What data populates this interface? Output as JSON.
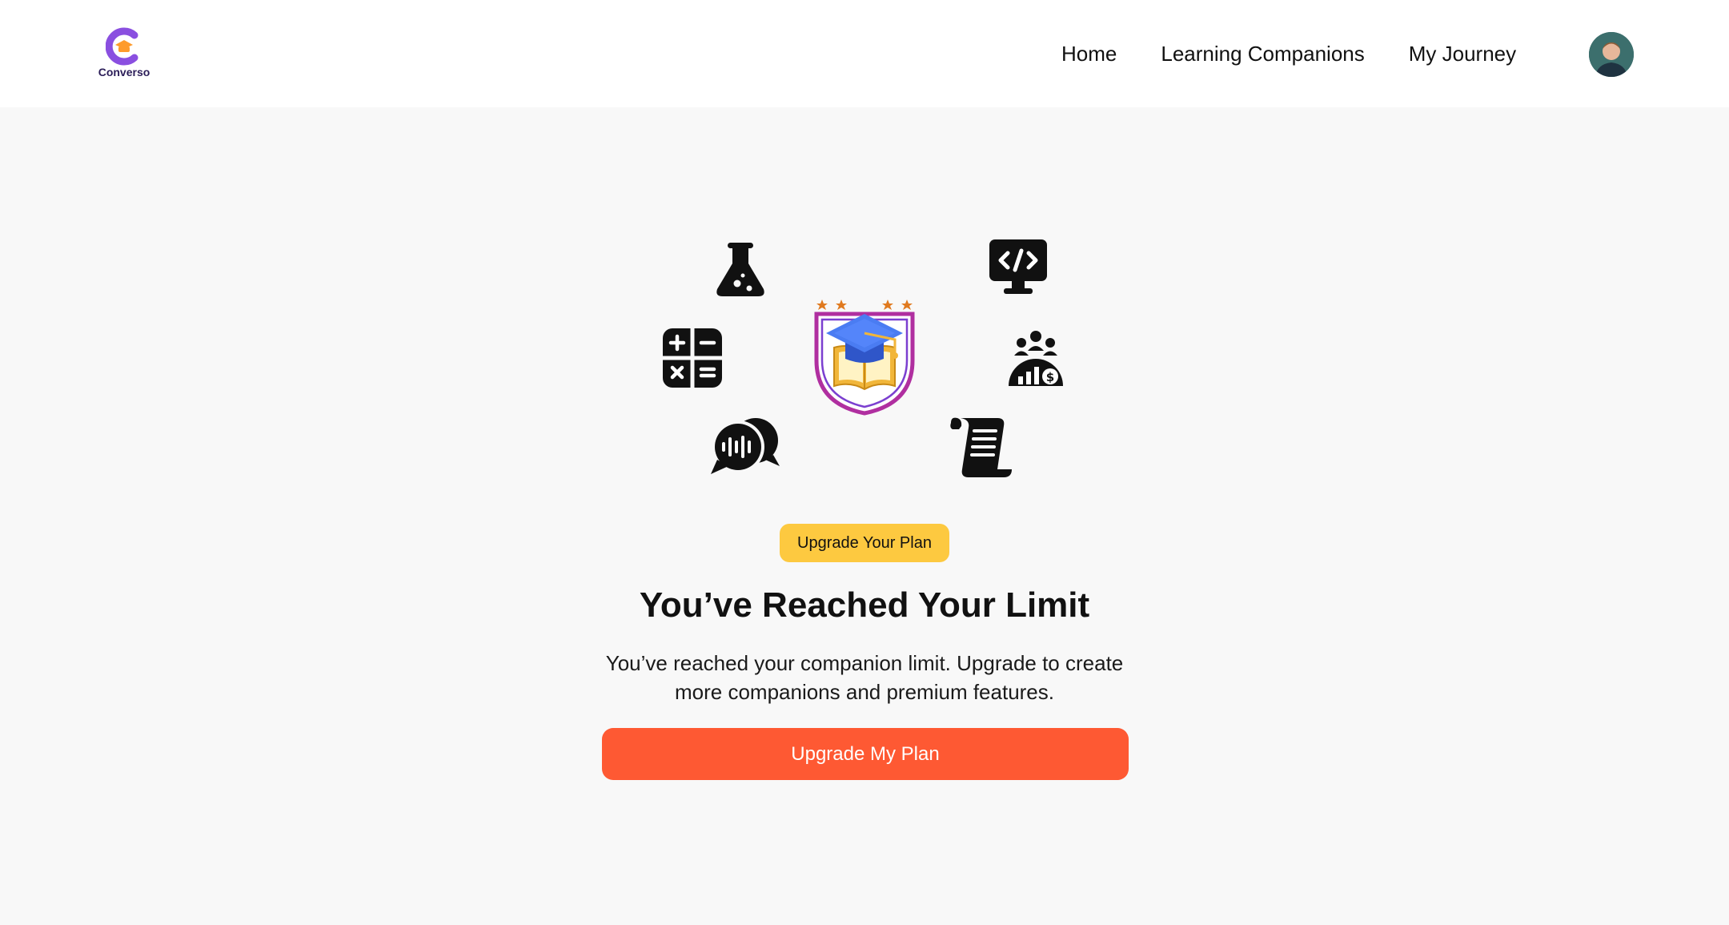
{
  "brand": {
    "name": "Converso",
    "primary_color": "#8a4fe0",
    "accent_color": "#fe9b2b"
  },
  "nav": {
    "links": [
      {
        "label": "Home"
      },
      {
        "label": "Learning Companions"
      },
      {
        "label": "My Journey"
      }
    ],
    "avatar_icon": "user-avatar"
  },
  "illustration": {
    "icons": [
      "flask-icon",
      "code-monitor-icon",
      "calculator-icon",
      "audience-finance-icon",
      "chat-voice-icon",
      "scroll-document-icon",
      "graduation-shield-badge"
    ]
  },
  "upgrade": {
    "badge_label": "Upgrade Your Plan",
    "title": "You’ve Reached Your Limit",
    "description": "You’ve reached your companion limit. Upgrade to create more companions and premium features.",
    "cta_label": "Upgrade My Plan",
    "badge_color": "#fdc940",
    "cta_color": "#fe5933"
  }
}
